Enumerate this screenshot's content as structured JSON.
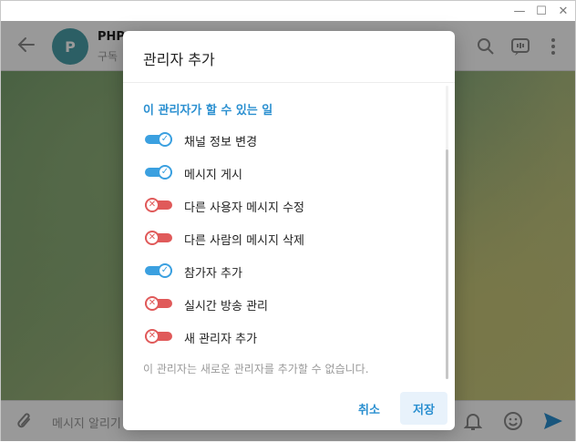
{
  "window": {
    "controls": [
      "—",
      "☐",
      "✕"
    ]
  },
  "header": {
    "channel_name": "PHP",
    "channel_sub": "구독"
  },
  "composer": {
    "placeholder": "메시지 알리기"
  },
  "dialog": {
    "title": "관리자 추가",
    "section": "이 관리자가 할 수 있는 일",
    "permissions": [
      {
        "label": "채널 정보 변경",
        "enabled": true
      },
      {
        "label": "메시지 게시",
        "enabled": true
      },
      {
        "label": "다른 사용자 메시지 수정",
        "enabled": false
      },
      {
        "label": "다른 사람의 메시지 삭제",
        "enabled": false
      },
      {
        "label": "참가자 추가",
        "enabled": true
      },
      {
        "label": "실시간 방송 관리",
        "enabled": false
      },
      {
        "label": "새 관리자 추가",
        "enabled": false
      }
    ],
    "note": "이 관리자는 새로운 관리자를 추가할 수 없습니다.",
    "cancel_label": "취소",
    "save_label": "저장"
  },
  "icons": {
    "back": "arrow-left-icon",
    "search": "search-icon",
    "live": "live-stream-icon",
    "more": "more-vert-icon",
    "attach": "paperclip-icon",
    "bell": "bell-icon",
    "emoji": "emoji-icon",
    "send": "send-icon"
  },
  "colors": {
    "accent": "#2a8fd0",
    "toggle_on": "#3ba0e0",
    "toggle_off": "#e05a5a"
  }
}
